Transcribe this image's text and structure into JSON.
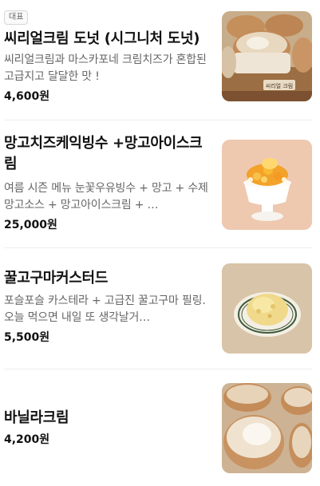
{
  "menu": {
    "items": [
      {
        "badge": "대표",
        "name": "씨리얼크림 도넛 (시그니처 도넛)",
        "description": "씨리얼크림과 마스카포네 크림치즈가 혼합된 고급지고 달달한 맛 !",
        "price": "4,600원",
        "photo_label": "씨리얼 크림"
      },
      {
        "name": "망고치즈케익빙수 +망고아이스크림",
        "description": "여름 시즌 메뉴 눈꽃우유빙수 + 망고 + 수제망고소스 + 망고아이스크림 + …",
        "price": "25,000원"
      },
      {
        "name": "꿀고구마커스터드",
        "description": "포슬포슬 카스테라 + 고급진 꿀고구마 필링. 오늘 먹으면 내일 또 생각날거…",
        "price": "5,500원"
      },
      {
        "name": "바닐라크림",
        "price": "4,200원"
      }
    ]
  },
  "colors": {
    "text": "#111111",
    "description": "#666666",
    "divider": "#eeeeee"
  }
}
